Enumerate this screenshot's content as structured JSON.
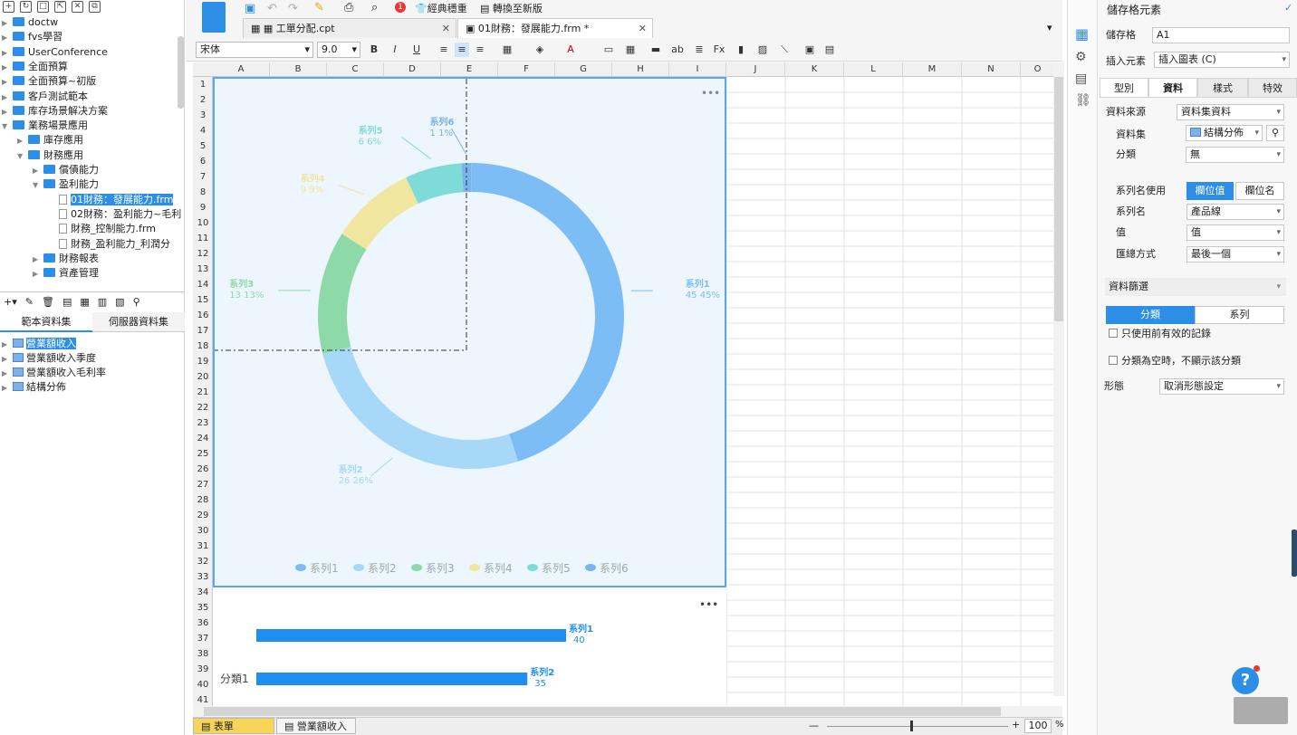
{
  "left_tree": [
    {
      "label": "doctw",
      "depth": 0,
      "type": "folder"
    },
    {
      "label": "fvs學習",
      "depth": 0,
      "type": "folder"
    },
    {
      "label": "UserConference",
      "depth": 0,
      "type": "folder"
    },
    {
      "label": "全面預算",
      "depth": 0,
      "type": "folder"
    },
    {
      "label": "全面預算~初版",
      "depth": 0,
      "type": "folder"
    },
    {
      "label": "客戶測試範本",
      "depth": 0,
      "type": "folder"
    },
    {
      "label": "库存场景解决方案",
      "depth": 0,
      "type": "folder"
    },
    {
      "label": "業務場景應用",
      "depth": 0,
      "type": "folder",
      "open": true
    },
    {
      "label": "庫存應用",
      "depth": 1,
      "type": "folder"
    },
    {
      "label": "財務應用",
      "depth": 1,
      "type": "folder",
      "open": true
    },
    {
      "label": "償債能力",
      "depth": 2,
      "type": "folder"
    },
    {
      "label": "盈利能力",
      "depth": 2,
      "type": "folder",
      "open": true
    },
    {
      "label": "01財務：發展能力.frm",
      "depth": 3,
      "type": "file",
      "selected": true
    },
    {
      "label": "02財務：盈利能力~毛利",
      "depth": 3,
      "type": "file"
    },
    {
      "label": "財務_控制能力.frm",
      "depth": 3,
      "type": "file"
    },
    {
      "label": "財務_盈利能力_利潤分",
      "depth": 3,
      "type": "file"
    },
    {
      "label": "財務報表",
      "depth": 2,
      "type": "folder"
    },
    {
      "label": "資產管理",
      "depth": 2,
      "type": "folder"
    }
  ],
  "ds_tabs": [
    "範本資料集",
    "伺服器資料集"
  ],
  "datasets": [
    {
      "label": "營業額收入",
      "selected": true
    },
    {
      "label": "營業額收入季度"
    },
    {
      "label": "營業額收入毛利率"
    },
    {
      "label": "結構分佈"
    }
  ],
  "toolbar": {
    "classic_label": "經典穩重",
    "switch_label": "轉換至新版",
    "badge": "1"
  },
  "tabs": [
    {
      "label": "工單分配.cpt",
      "active": false
    },
    {
      "label": "01財務：發展能力.frm *",
      "active": true
    }
  ],
  "format": {
    "font": "宋体",
    "size": "9.0"
  },
  "columns": [
    "A",
    "B",
    "C",
    "D",
    "E",
    "F",
    "G",
    "H",
    "I",
    "J",
    "K",
    "L",
    "M",
    "N",
    "O"
  ],
  "rows": [
    "1",
    "2",
    "3",
    "4",
    "5",
    "6",
    "7",
    "8",
    "9",
    "10",
    "11",
    "12",
    "13",
    "14",
    "15",
    "16",
    "17",
    "18",
    "19",
    "20",
    "21",
    "22",
    "23",
    "24",
    "25",
    "26",
    "27",
    "28",
    "29",
    "30",
    "31",
    "32",
    "33",
    "34",
    "35",
    "36",
    "37",
    "38",
    "39",
    "40",
    "41"
  ],
  "chart_data": [
    {
      "type": "pie",
      "donut": true,
      "series": [
        {
          "name": "系列1",
          "value": 45,
          "percent": "45%",
          "color": "#7dbdf5"
        },
        {
          "name": "系列2",
          "value": 26,
          "percent": "26%",
          "color": "#a8d8f8"
        },
        {
          "name": "系列3",
          "value": 13,
          "percent": "13%",
          "color": "#8ed9a8"
        },
        {
          "name": "系列4",
          "value": 9,
          "percent": "9%",
          "color": "#f1e6a0"
        },
        {
          "name": "系列5",
          "value": 6,
          "percent": "6%",
          "color": "#7fdbd8"
        },
        {
          "name": "系列6",
          "value": 1,
          "percent": "1%",
          "color": "#7ab4ee"
        }
      ],
      "legend": [
        "系列1",
        "系列2",
        "系列3",
        "系列4",
        "系列5",
        "系列6"
      ],
      "legend_position": "bottom"
    },
    {
      "type": "bar",
      "orientation": "horizontal",
      "categories": [
        "分類1"
      ],
      "series": [
        {
          "name": "系列1",
          "values": [
            40
          ]
        },
        {
          "name": "系列2",
          "values": [
            35
          ]
        }
      ],
      "xlim": [
        0,
        45
      ]
    }
  ],
  "sheets": [
    "表單",
    "營業額收入"
  ],
  "zoom": "100",
  "zoom_unit": "%",
  "right": {
    "title": "儲存格元素",
    "cell_label": "儲存格",
    "cell_value": "A1",
    "insert_label": "插入元素",
    "insert_value": "插入圖表 (C)",
    "tabs": [
      "型別",
      "資料",
      "樣式",
      "特效"
    ],
    "source_label": "資料來源",
    "source_value": "資料集資料",
    "dataset_label": "資料集",
    "dataset_value": "結構分佈",
    "category_label": "分類",
    "category_value": "無",
    "series_name_use_label": "系列名使用",
    "series_opt1": "欄位值",
    "series_opt2": "欄位名",
    "series_name_label": "系列名",
    "series_name_value": "產品線",
    "value_label": "值",
    "value_value": "值",
    "summary_label": "匯總方式",
    "summary_value": "最後一個",
    "filter_label": "資料篩選",
    "filter_tab1": "分類",
    "filter_tab2": "系列",
    "check1": "只使用前有效的記錄",
    "check2": "分類為空時，不顯示該分類",
    "shape_label": "形態",
    "shape_value": "取消形態設定"
  }
}
